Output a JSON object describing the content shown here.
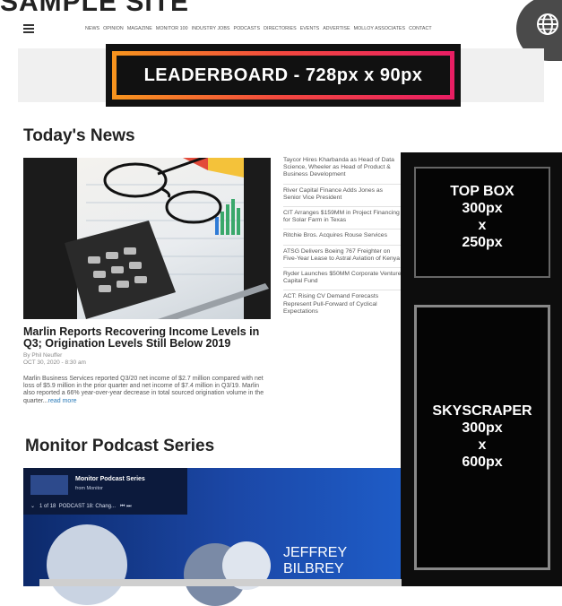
{
  "header": {
    "logo_text": "SAMPLE SITE",
    "nav_items": [
      "NEWS",
      "OPINION",
      "MAGAZINE",
      "MONITOR 100",
      "INDUSTRY JOBS",
      "PODCASTS",
      "DIRECTORIES",
      "EVENTS",
      "ADVERTISE",
      "MOLLOY ASSOCIATES",
      "CONTACT"
    ],
    "menu_icon": "hamburger-menu-icon",
    "globe_icon": "globe-icon"
  },
  "ads": {
    "leaderboard": "LEADERBOARD  - 728px x 90px",
    "top_box_lines": [
      "TOP BOX",
      "300px",
      "x",
      "250px"
    ],
    "skyscraper_lines": [
      "SKYSCRAPER",
      "300px",
      "x",
      "600px"
    ]
  },
  "today": {
    "heading": "Today's News",
    "feature": {
      "title": "Marlin Reports Recovering Income Levels in Q3; Origination Levels Still Below 2019",
      "byline": "By Phil Neuffer",
      "date": "OCT 30, 2020 - 8:30 am",
      "excerpt": "Marlin Business Services reported Q3/20 net income of $2.7 million compared with net loss of $5.9 million in the prior quarter and net income of $7.4 million in Q3/19. Marlin also reported a 66% year-over-year decrease in total sourced origination volume in the quarter...",
      "read_more": "read more"
    },
    "headlines": [
      "Taycor Hires Kharbanda as Head of Data Science, Wheeler as Head of Product & Business Development",
      "River Capital Finance Adds Jones as Senior Vice President",
      "CIT Arranges $159MM in Project Financing for Solar Farm in Texas",
      "Ritchie Bros. Acquires Rouse Services",
      "ATSG Delivers Boeing 767 Freighter on Five-Year Lease to Astral Aviation of Kenya",
      "Ryder Launches $50MM Corporate Venture Capital Fund",
      "ACT: Rising CV Demand Forecasts Represent Pull-Forward of Cyclical Expectations"
    ]
  },
  "podcast": {
    "heading": "Monitor Podcast Series",
    "player_title": "Monitor Podcast Series",
    "player_sub": "from Monitor",
    "counter": "1 of 18",
    "episode": "PODCAST 18: Chang...",
    "guest_first": "JEFFREY",
    "guest_last": "BILBREY"
  }
}
